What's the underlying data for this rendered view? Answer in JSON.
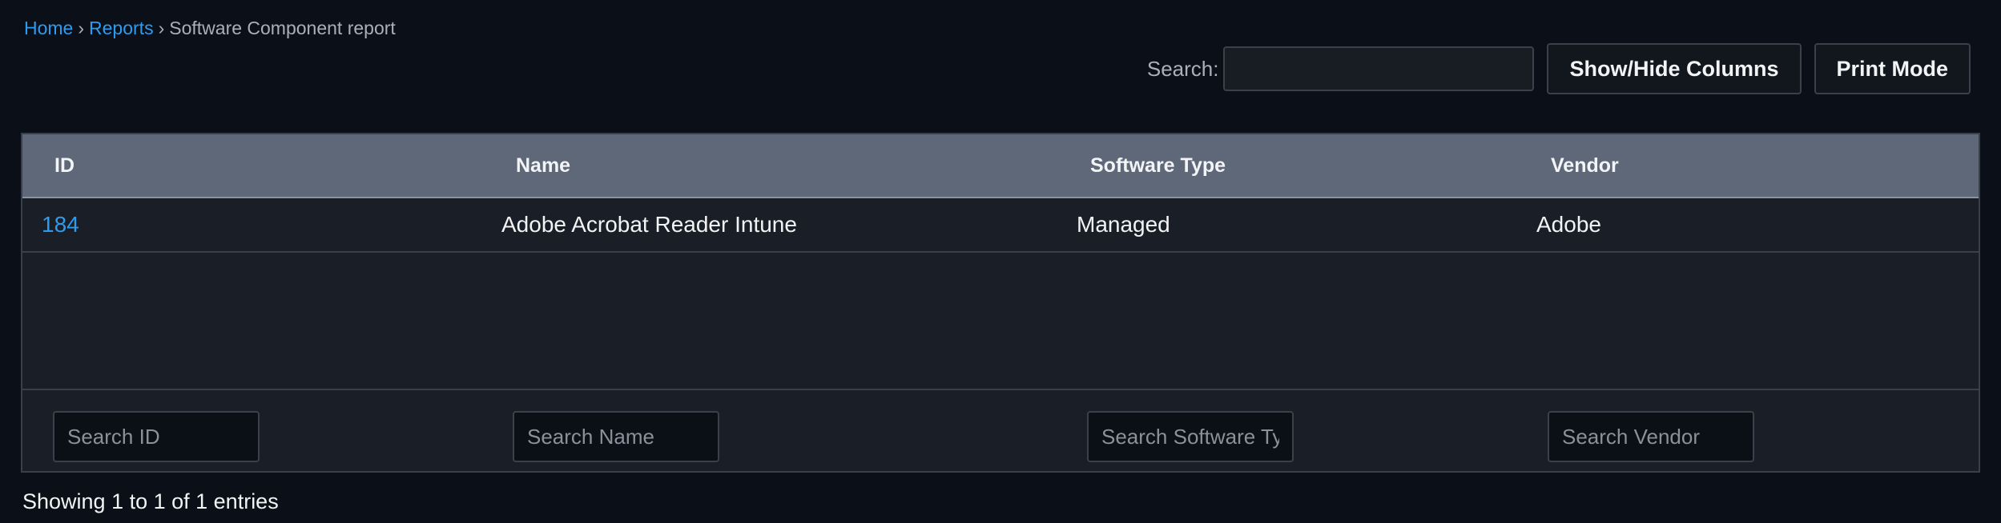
{
  "breadcrumb": {
    "home": "Home",
    "sep1": "›",
    "reports": "Reports",
    "sep2": "›",
    "current": "Software Component report"
  },
  "toolbar": {
    "search_label": "Search:",
    "search_value": "",
    "show_hide_columns": "Show/Hide Columns",
    "print_mode": "Print Mode"
  },
  "table": {
    "columns": [
      "ID",
      "Name",
      "Software Type",
      "Vendor"
    ],
    "rows": [
      {
        "id": "184",
        "name": "Adobe Acrobat Reader Intune",
        "type": "Managed",
        "vendor": "Adobe"
      }
    ],
    "filter_placeholders": [
      "Search ID",
      "Search Name",
      "Search Software Type",
      "Search Vendor"
    ]
  },
  "info": "Showing 1 to 1 of 1 entries",
  "colors": {
    "background": "#0b0f17",
    "link": "#2d9cf0",
    "header_bg": "#5f6878",
    "table_bg": "#1a1e26"
  }
}
